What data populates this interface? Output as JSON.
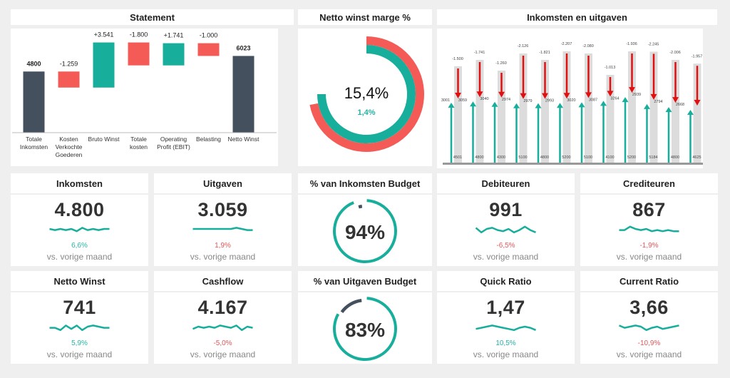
{
  "colors": {
    "teal": "#17ae9c",
    "red": "#f45b57",
    "dark": "#44505e",
    "arrow_red": "#e01010",
    "grey_bar": "#dcdcdc",
    "positive_text": "#24b3a3",
    "negative_text": "#e0575a"
  },
  "statement": {
    "title": "Statement",
    "chart_data": {
      "type": "waterfall",
      "categories": [
        "Totale Inkomsten",
        "Kosten Verkochte Goederen",
        "Bruto Winst",
        "Totale kosten",
        "Operating Profit (EBIT)",
        "Belasting",
        "Netto Winst"
      ],
      "category_lines": [
        [
          "Totale",
          "Inkomsten"
        ],
        [
          "Kosten",
          "Verkochte",
          "Goederen"
        ],
        [
          "Bruto Winst"
        ],
        [
          "Totale",
          "kosten"
        ],
        [
          "Operating",
          "Profit (EBIT)"
        ],
        [
          "Belasting"
        ],
        [
          "Netto Winst"
        ]
      ],
      "values": [
        4800,
        -1259,
        3541,
        -1800,
        1741,
        -1000,
        6023
      ],
      "labels": [
        "4800",
        "-1.259",
        "+3.541",
        "-1.800",
        "+1.741",
        "-1.000",
        "6023"
      ],
      "kinds": [
        "total",
        "negative",
        "positive",
        "negative",
        "positive",
        "negative",
        "total"
      ]
    }
  },
  "marge": {
    "title": "Netto winst marge %",
    "value": "15,4%",
    "change": "1,4%",
    "chart_data": {
      "type": "radial",
      "outer_fraction": 0.72,
      "inner_fraction": 0.75
    }
  },
  "inkomsten_uitgaven": {
    "title": "Inkomsten en uitgaven",
    "chart_data": {
      "type": "bar",
      "income": [
        4501,
        4800,
        4300,
        5100,
        4800,
        5200,
        5100,
        4100,
        5200,
        5184,
        4800,
        4625
      ],
      "income_labels": [
        "4501",
        "4800",
        "4300",
        "5100",
        "4800",
        "5200",
        "5100",
        "4100",
        "5200",
        "5184",
        "4800",
        "4625"
      ],
      "expenses": [
        -1500,
        -1741,
        -1260,
        -2126,
        -1821,
        -2207,
        -2080,
        -1013,
        -1936,
        -2245,
        -2006,
        -1957
      ],
      "expense_labels": [
        "-1.500",
        "-1.741",
        "-1.260",
        "-2.126",
        "-1.821",
        "-2.207",
        "-2.080",
        "-1.013",
        "-1.936",
        "-2.245",
        "-2.006",
        "-1.957"
      ],
      "net_labels": [
        "3059",
        "3040",
        "2974",
        "2979",
        "2993",
        "3020",
        "3087",
        "3264",
        "2939",
        "2794",
        "2668",
        ""
      ],
      "extra_label": "3001"
    }
  },
  "kpis": [
    {
      "title": "Inkomsten",
      "value": "4.800",
      "pct": "6,6%",
      "trend": "pos",
      "sub": "vs. vorige maand",
      "spark": [
        5,
        4,
        5,
        4,
        5,
        3,
        6,
        4,
        5,
        4,
        5,
        5
      ]
    },
    {
      "title": "Uitgaven",
      "value": "3.059",
      "pct": "1,9%",
      "trend": "neg",
      "sub": "vs. vorige maand",
      "spark": [
        5,
        5,
        5,
        5,
        5,
        5,
        5,
        5,
        6,
        5,
        4,
        4
      ]
    },
    {
      "title": "Debiteuren",
      "value": "991",
      "pct": "-6,5%",
      "trend": "neg",
      "sub": "vs. vorige maand",
      "spark": [
        6,
        2,
        5,
        6,
        4,
        3,
        5,
        2,
        4,
        7,
        4,
        2
      ]
    },
    {
      "title": "Crediteuren",
      "value": "867",
      "pct": "-1,9%",
      "trend": "neg",
      "sub": "vs. vorige maand",
      "spark": [
        4,
        4,
        7,
        5,
        4,
        5,
        3,
        4,
        3,
        4,
        3,
        3
      ]
    },
    {
      "title": "Netto Winst",
      "value": "741",
      "pct": "5,9%",
      "trend": "pos",
      "sub": "vs. vorige maand",
      "spark": [
        4,
        4,
        2,
        6,
        3,
        6,
        2,
        5,
        6,
        5,
        4,
        4
      ]
    },
    {
      "title": "Cashflow",
      "value": "4.167",
      "pct": "-5,0%",
      "trend": "neg",
      "sub": "vs. vorige maand",
      "spark": [
        3,
        5,
        4,
        5,
        4,
        6,
        5,
        4,
        6,
        2,
        5,
        4
      ]
    },
    {
      "title": "Quick Ratio",
      "value": "1,47",
      "pct": "10,5%",
      "trend": "pos",
      "sub": "vs. vorige maand",
      "spark": [
        3,
        4,
        5,
        6,
        5,
        4,
        3,
        2,
        4,
        5,
        4,
        2
      ]
    },
    {
      "title": "Current Ratio",
      "value": "3,66",
      "pct": "-10,9%",
      "trend": "neg",
      "sub": "vs. vorige maand",
      "spark": [
        6,
        4,
        5,
        6,
        5,
        2,
        4,
        5,
        3,
        4,
        5,
        6
      ]
    }
  ],
  "budgets": [
    {
      "title": "% van Inkomsten Budget",
      "value": "94%",
      "fraction": 0.94
    },
    {
      "title": "% van Uitgaven Budget",
      "value": "83%",
      "fraction": 0.83
    }
  ]
}
